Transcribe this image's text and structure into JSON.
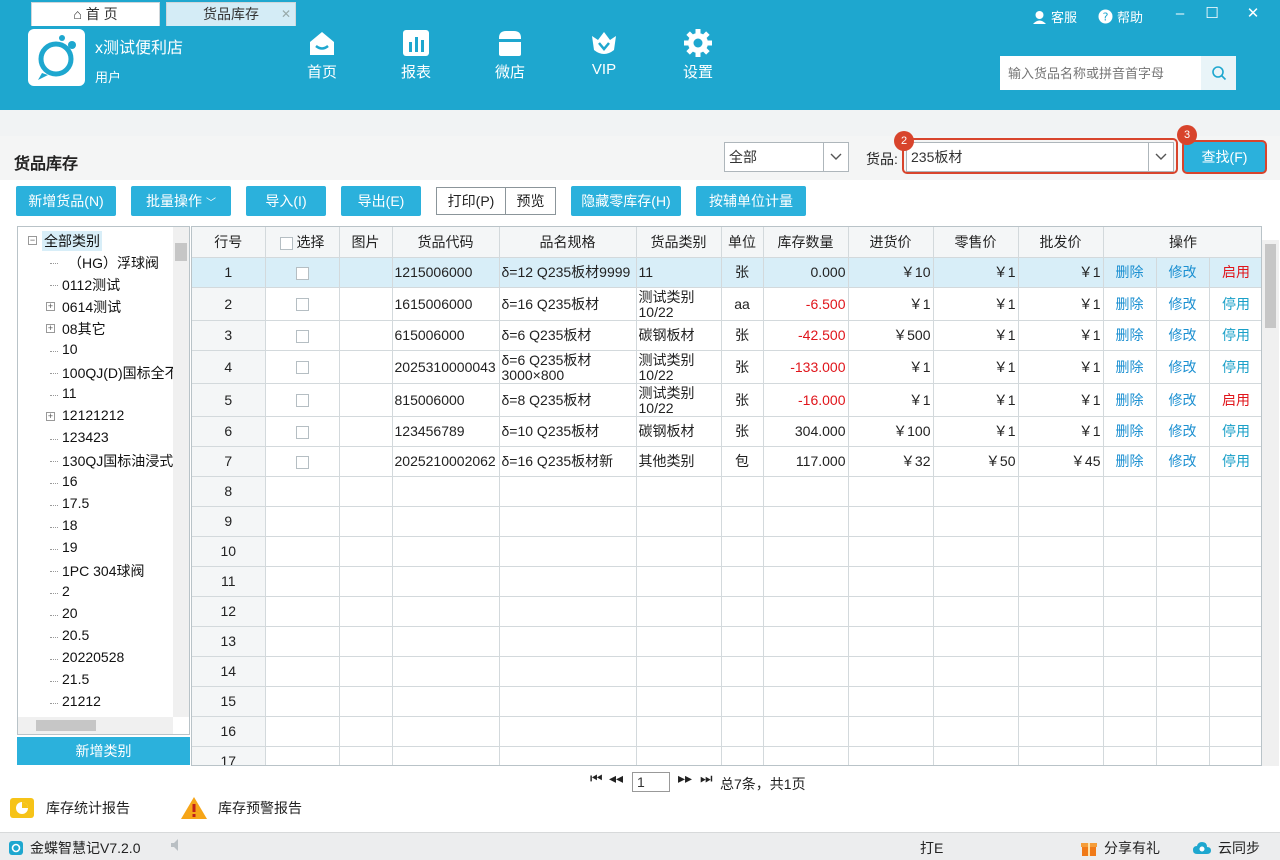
{
  "header": {
    "shop_name": "x测试便利店",
    "user": "用户",
    "nav": [
      "首页",
      "报表",
      "微店",
      "VIP",
      "设置"
    ],
    "support": "客服",
    "help": "帮助",
    "search_placeholder": "输入货品名称或拼音首字母"
  },
  "tabs": {
    "home": "首 页",
    "inventory": "货品库存"
  },
  "page": {
    "title": "货品库存",
    "filter_value": "全部",
    "goods_label": "货品:",
    "goods_value": "235板材",
    "find_label": "查找(F)",
    "badge_goods": "2",
    "badge_find": "3"
  },
  "toolbar": {
    "add": "新增货品(N)",
    "batch": "批量操作",
    "import": "导入(I)",
    "export": "导出(E)",
    "print": "打印(P)",
    "preview": "预览",
    "hide_zero": "隐藏零库存(H)",
    "aux_unit": "按辅单位计量"
  },
  "tree": {
    "root": "全部类别",
    "items": [
      "（HG）浮球阀",
      "0112测试",
      "0614测试",
      "08其它",
      "10",
      "100QJ(D)国标全不",
      "11",
      "12121212",
      "123423",
      "130QJ国标油浸式",
      "16",
      "17.5",
      "18",
      "19",
      "1PC 304球阀",
      "2",
      "20",
      "20.5",
      "20220528",
      "21.5",
      "21212"
    ],
    "expandable": [
      false,
      false,
      true,
      true,
      false,
      false,
      false,
      true,
      false,
      false,
      false,
      false,
      false,
      false,
      false,
      false,
      false,
      false,
      false,
      false,
      false
    ],
    "add_category": "新增类别"
  },
  "grid": {
    "columns": [
      "行号",
      "选择",
      "图片",
      "货品代码",
      "品名规格",
      "货品类别",
      "单位",
      "库存数量",
      "进货价",
      "零售价",
      "批发价",
      "操作"
    ],
    "rows": [
      {
        "no": "1",
        "code": "1215006000",
        "name": "δ=12 Q235板材9999",
        "cat": "11",
        "unit": "张",
        "qty": "0.000",
        "buy": "￥10",
        "retail": "￥1",
        "wholesale": "￥1",
        "del": "删除",
        "edit": "修改",
        "toggle": "启用",
        "neg": false,
        "enabled": false
      },
      {
        "no": "2",
        "code": "1615006000",
        "name": "δ=16 Q235板材",
        "cat": "测试类别10/22",
        "unit": "aa",
        "qty": "-6.500",
        "buy": "￥1",
        "retail": "￥1",
        "wholesale": "￥1",
        "del": "删除",
        "edit": "修改",
        "toggle": "停用",
        "neg": true,
        "enabled": true
      },
      {
        "no": "3",
        "code": "615006000",
        "name": "δ=6 Q235板材",
        "cat": "碳钢板材",
        "unit": "张",
        "qty": "-42.500",
        "buy": "￥500",
        "retail": "￥1",
        "wholesale": "￥1",
        "del": "删除",
        "edit": "修改",
        "toggle": "停用",
        "neg": true,
        "enabled": true
      },
      {
        "no": "4",
        "code": "2025310000043",
        "name": "δ=6 Q235板材3000×800",
        "cat": "测试类别10/22",
        "unit": "张",
        "qty": "-133.000",
        "buy": "￥1",
        "retail": "￥1",
        "wholesale": "￥1",
        "del": "删除",
        "edit": "修改",
        "toggle": "停用",
        "neg": true,
        "enabled": true
      },
      {
        "no": "5",
        "code": "815006000",
        "name": "δ=8 Q235板材",
        "cat": "测试类别10/22",
        "unit": "张",
        "qty": "-16.000",
        "buy": "￥1",
        "retail": "￥1",
        "wholesale": "￥1",
        "del": "删除",
        "edit": "修改",
        "toggle": "启用",
        "neg": true,
        "enabled": false
      },
      {
        "no": "6",
        "code": "123456789",
        "name": "δ=10 Q235板材",
        "cat": "碳钢板材",
        "unit": "张",
        "qty": "304.000",
        "buy": "￥100",
        "retail": "￥1",
        "wholesale": "￥1",
        "del": "删除",
        "edit": "修改",
        "toggle": "停用",
        "neg": false,
        "enabled": true
      },
      {
        "no": "7",
        "code": "2025210002062",
        "name": "δ=16 Q235板材新",
        "cat": "其他类别",
        "unit": "包",
        "qty": "117.000",
        "buy": "￥32",
        "retail": "￥50",
        "wholesale": "￥45",
        "del": "删除",
        "edit": "修改",
        "toggle": "停用",
        "neg": false,
        "enabled": true
      }
    ],
    "empty_rows": [
      "8",
      "9",
      "10",
      "11",
      "12",
      "13",
      "14",
      "15",
      "16",
      "17"
    ]
  },
  "pager": {
    "page": "1",
    "summary": "总7条，共1页"
  },
  "reports": {
    "stats": "库存统计报告",
    "warning": "库存预警报告"
  },
  "status": {
    "version": "金蝶智慧记V7.2.0",
    "print": "打E",
    "share": "分享有礼",
    "sync": "云同步"
  },
  "colors": {
    "brand": "#1ea7cf",
    "button": "#2bb1dc",
    "highlight": "#d8442c",
    "negative": "#e0151b",
    "link": "#1a8fd1"
  }
}
